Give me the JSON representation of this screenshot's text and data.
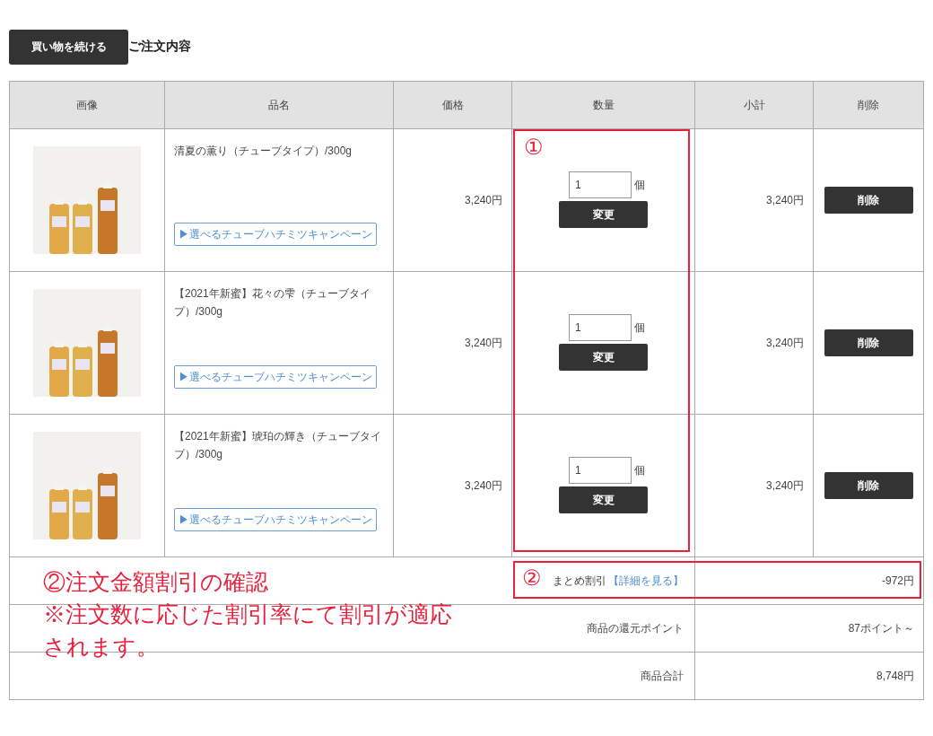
{
  "continue_button": "買い物を続ける",
  "section_title": "ご注文内容",
  "table": {
    "columns": [
      "画像",
      "品名",
      "価格",
      "数量",
      "小計",
      "削除"
    ],
    "rows": [
      {
        "name": "清夏の薫り（チューブタイプ）/300g",
        "campaign_link": "▶選べるチューブハチミツキャンペーン",
        "price": "3,240円",
        "quantity": "1",
        "unit": "個",
        "change_button": "変更",
        "subtotal": "3,240円",
        "delete_button": "削除"
      },
      {
        "name": "【2021年新蜜】花々の雫（チューブタイプ）/300g",
        "campaign_link": "▶選べるチューブハチミツキャンペーン",
        "price": "3,240円",
        "quantity": "1",
        "unit": "個",
        "change_button": "変更",
        "subtotal": "3,240円",
        "delete_button": "削除"
      },
      {
        "name": "【2021年新蜜】琥珀の輝き（チューブタイプ）/300g",
        "campaign_link": "▶選べるチューブハチミツキャンペーン",
        "price": "3,240円",
        "quantity": "1",
        "unit": "個",
        "change_button": "変更",
        "subtotal": "3,240円",
        "delete_button": "削除"
      }
    ]
  },
  "summary": [
    {
      "label": "まとめ割引",
      "link": "【詳細を見る】",
      "value": "-972円"
    },
    {
      "label": "商品の還元ポイント",
      "value": "87ポイント～"
    },
    {
      "label": "商品合計",
      "value": "8,748円"
    }
  ],
  "annotations": {
    "quantity_marker": "①",
    "discount_marker": "②",
    "note_title": "②注文金額割引の確認",
    "note_body": "※注文数に応じた割引率にて割引が適応されます。"
  }
}
